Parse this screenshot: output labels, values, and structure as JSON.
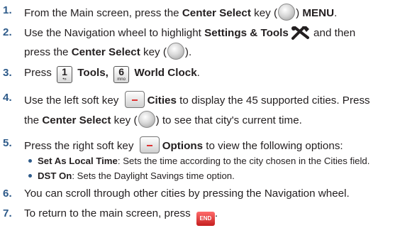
{
  "steps": [
    {
      "num": "1.",
      "t1": "From the Main screen, press the ",
      "b1": "Center Select",
      "t2": " key (",
      "t3": ") ",
      "b2": "MENU",
      "t4": "."
    },
    {
      "num": "2.",
      "t1": "Use the Navigation wheel to highlight ",
      "b1": "Settings & Tools",
      "t2": " and then"
    },
    {
      "t1": "press the ",
      "b1": "Center Select",
      "t2": " key (",
      "t3": ")."
    },
    {
      "num": "3.",
      "t1": "Press ",
      "k1big": "1",
      "k1small": "•»",
      "b1": "Tools,",
      "k2big": "6",
      "k2small": "mno",
      "b2": "World Clock",
      "t2": "."
    },
    {
      "num": "4.",
      "t1": "Use the left soft key ",
      "b1": "Cities",
      "t2": " to display the 45 supported cities. Press"
    },
    {
      "t1": "the ",
      "b1": "Center Select",
      "t2": " key (",
      "t3": ") to see that city's current time."
    },
    {
      "num": "5.",
      "t1": "Press the right soft key ",
      "b1": "Options",
      "t2": " to view the following options:"
    },
    {
      "num": "6.",
      "t1": "You can scroll through other cities by pressing the Navigation wheel."
    },
    {
      "num": "7.",
      "t1": "To return to the main screen, press ",
      "t2": "."
    }
  ],
  "bullets": [
    {
      "b": "Set As Local Time",
      "t": ": Sets the time according to the city chosen in the Cities field."
    },
    {
      "b": "DST On",
      "t": ": Sets the Daylight Savings time option."
    }
  ],
  "end_key_label": "END",
  "colors": {
    "number": "#2e5b8a",
    "text": "#231f20",
    "end_key": "#d32f2f"
  },
  "icons": [
    "center-select-key-icon",
    "tools-icon",
    "keypad-1-icon",
    "keypad-6-icon",
    "left-soft-key-icon",
    "right-soft-key-icon",
    "end-key-icon"
  ]
}
